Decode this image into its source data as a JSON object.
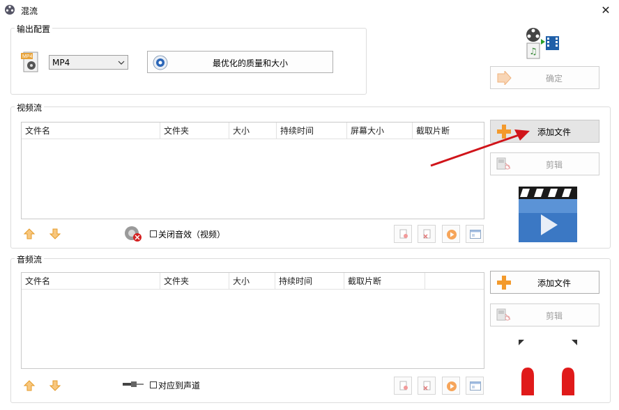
{
  "window": {
    "title": "混流",
    "close_glyph": "✕"
  },
  "output_config": {
    "label": "输出配置",
    "format_value": "MP4",
    "quality_button": "最优化的质量和大小",
    "confirm_button": "确定",
    "format_icon_text": "MP4"
  },
  "video": {
    "label": "视频流",
    "columns": [
      "文件名",
      "文件夹",
      "大小",
      "持续时间",
      "屏幕大小",
      "截取片断"
    ],
    "add_button": "添加文件",
    "edit_button": "剪辑",
    "mute_label": "关闭音效（视频）"
  },
  "audio": {
    "label": "音频流",
    "columns": [
      "文件名",
      "文件夹",
      "大小",
      "持续时间",
      "截取片断"
    ],
    "add_button": "添加文件",
    "edit_button": "剪辑",
    "channel_label": "对应到声道"
  },
  "colors": {
    "accent_orange": "#f59a23",
    "arrow_red": "#d0141a",
    "film_blue": "#3b78c4"
  }
}
